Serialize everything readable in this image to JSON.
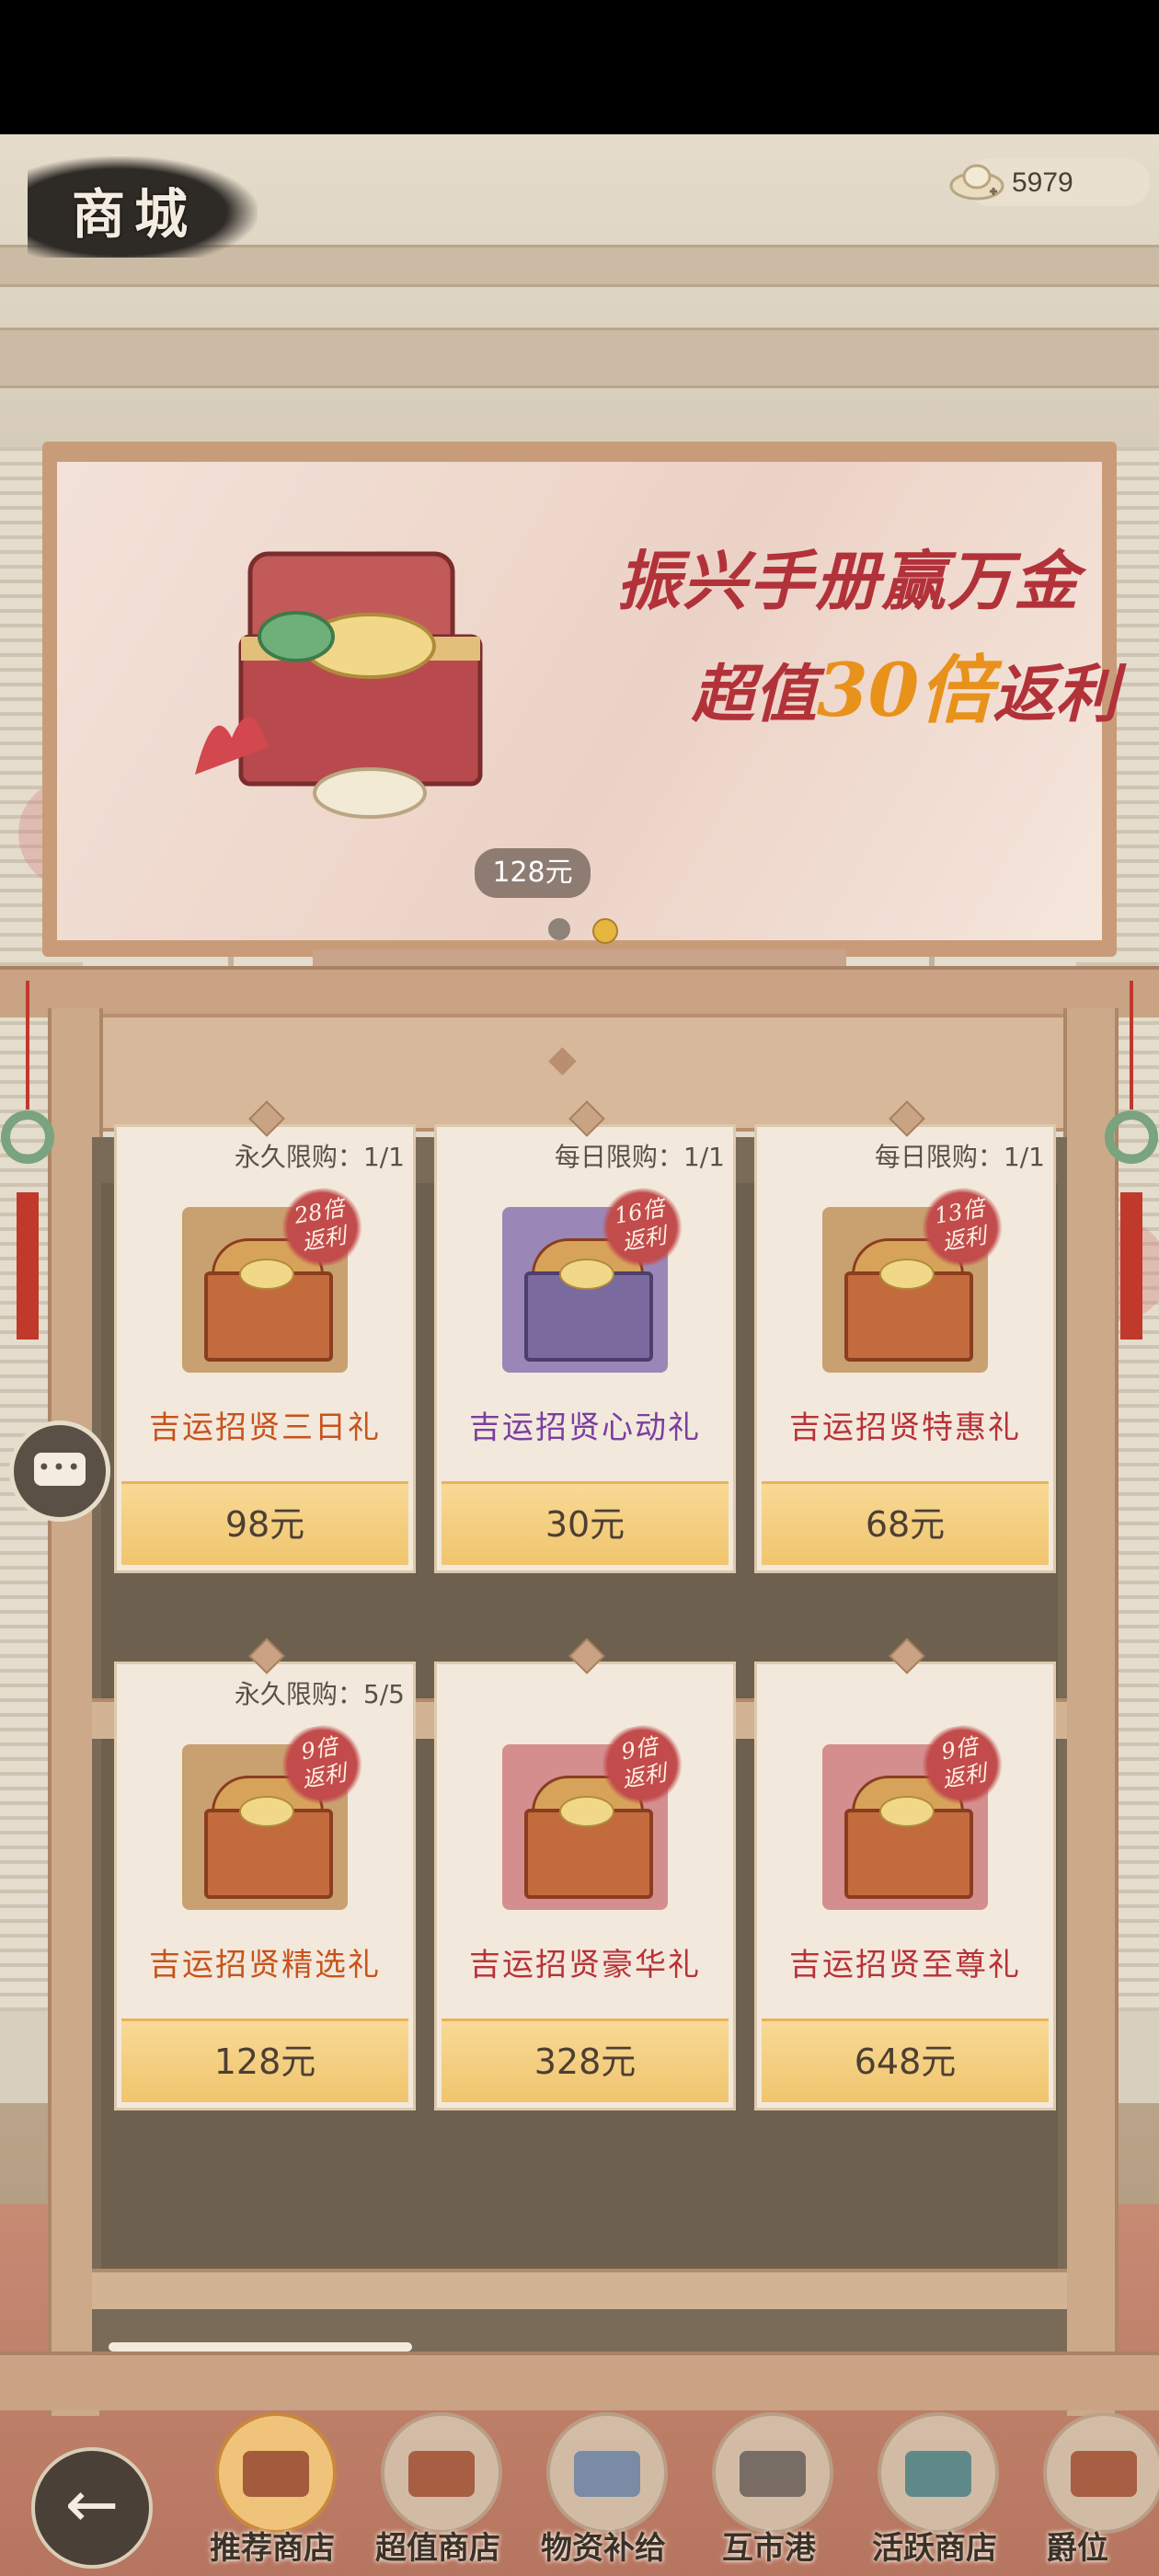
{
  "header": {
    "title": "商城",
    "currency_icon": "gold-ingot-icon",
    "currency_value": "5979"
  },
  "banner": {
    "line1": "振兴手册赢万金",
    "line2_prefix": "超值",
    "line2_highlight": "30倍",
    "line2_suffix": "返利",
    "price": "128元",
    "carousel_active_index": 1,
    "carousel_count": 2
  },
  "colors": {
    "name_orange": "#c8531c",
    "name_purple": "#7b3ea0",
    "name_red": "#b83238",
    "button": "#f0c56e",
    "tag_red": "#c24c4c"
  },
  "packs": [
    {
      "limit": "永久限购：1/1",
      "tag_line1": "28倍",
      "tag_line2": "返利",
      "name": "吉运招贤三日礼",
      "price": "98元"
    },
    {
      "limit": "每日限购：1/1",
      "tag_line1": "16倍",
      "tag_line2": "返利",
      "name": "吉运招贤心动礼",
      "price": "30元"
    },
    {
      "limit": "每日限购：1/1",
      "tag_line1": "13倍",
      "tag_line2": "返利",
      "name": "吉运招贤特惠礼",
      "price": "68元"
    },
    {
      "limit": "永久限购：5/5",
      "tag_line1": "9倍",
      "tag_line2": "返利",
      "name": "吉运招贤精选礼",
      "price": "128元"
    },
    {
      "limit": "",
      "tag_line1": "9倍",
      "tag_line2": "返利",
      "name": "吉运招贤豪华礼",
      "price": "328元"
    },
    {
      "limit": "",
      "tag_line1": "9倍",
      "tag_line2": "返利",
      "name": "吉运招贤至尊礼",
      "price": "648元"
    }
  ],
  "chat_icon": "chat-bubble-icon",
  "nav": {
    "back_icon": "back-arrow-icon",
    "tabs": [
      "推荐商店",
      "超值商店",
      "物资补给",
      "互市港",
      "活跃商店",
      "爵位"
    ],
    "active_tab": 0
  }
}
